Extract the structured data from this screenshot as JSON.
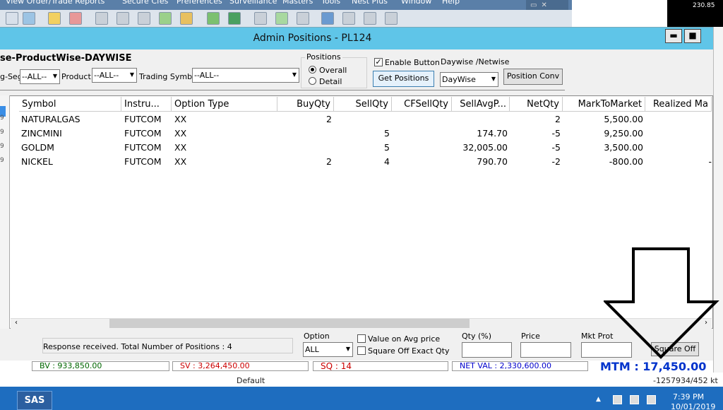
{
  "menu": [
    "View Order/Trade Reports",
    "Secure Cfes",
    "Preferences",
    "Surveillance",
    "Masters",
    "Tools",
    "Nest Plus",
    "Window",
    "Help"
  ],
  "window": {
    "title": "Admin Positions - PL124",
    "minimize": "▬",
    "maximize": "■"
  },
  "heading": "se-ProductWise-DAYWISE",
  "filters": {
    "exseg_label": "g-Seg",
    "exseg_value": "--ALL--",
    "product_label": "Product",
    "product_value": "--ALL--",
    "trading_symbol_label": "Trading Symbol",
    "trading_symbol_value": "--ALL--",
    "positions_group": "Positions",
    "overall": "Overall",
    "detail": "Detail",
    "enable_button": "Enable Button",
    "get_positions": "Get Positions",
    "daywise_label": "Daywise /Netwise",
    "daywise_value": "DayWise",
    "position_conv": "Position Conv"
  },
  "table": {
    "columns": [
      "Symbol",
      "Instru...",
      "Option Type",
      "BuyQty",
      "SellQty",
      "CFSellQty",
      "SellAvgP...",
      "NetQty",
      "MarkToMarket",
      "Realized Ma"
    ],
    "rows": [
      {
        "symbol": "NATURALGAS",
        "instrument": "FUTCOM",
        "option": "XX",
        "buyqty": "2",
        "sellqty": "",
        "cfsellqty": "",
        "sellavg": "",
        "netqty": "2",
        "mtm": "5,500.00",
        "realized": ""
      },
      {
        "symbol": "ZINCMINI",
        "instrument": "FUTCOM",
        "option": "XX",
        "buyqty": "",
        "sellqty": "5",
        "cfsellqty": "",
        "sellavg": "174.70",
        "netqty": "-5",
        "mtm": "9,250.00",
        "realized": ""
      },
      {
        "symbol": "GOLDM",
        "instrument": "FUTCOM",
        "option": "XX",
        "buyqty": "",
        "sellqty": "5",
        "cfsellqty": "",
        "sellavg": "32,005.00",
        "netqty": "-5",
        "mtm": "3,500.00",
        "realized": ""
      },
      {
        "symbol": "NICKEL",
        "instrument": "FUTCOM",
        "option": "XX",
        "buyqty": "2",
        "sellqty": "4",
        "cfsellqty": "",
        "sellavg": "790.70",
        "netqty": "-2",
        "mtm": "-800.00",
        "realized": "-"
      }
    ]
  },
  "bottom": {
    "response": "Response received. Total Number of Positions : 4",
    "option_label": "Option",
    "option_value": "ALL",
    "value_on_avg": "Value on Avg  price",
    "square_off_exact": "Square Off Exact Qty",
    "qty_label": "Qty (%)",
    "price_label": "Price",
    "mkt_prot_label": "Mkt Prot",
    "square_off": "Square Off"
  },
  "status": {
    "bv": "BV : 933,850.00",
    "sv": "SV : 3,264,450.00",
    "sq": "SQ : 14",
    "net_val": "NET VAL : 2,330,600.00",
    "mtm": "MTM : 17,450.00"
  },
  "background": {
    "default_text": "Default",
    "right_number": "-1257934/452 kt",
    "chart_value": "230.85"
  },
  "taskbar": {
    "app": "SAS",
    "time": "7:39 PM",
    "date": "10/01/2019"
  },
  "colors": {
    "titlebar": "#5fc5e8",
    "taskbar": "#1e6dbf",
    "mtm": "#0033cc",
    "sv": "#cc0000",
    "sq": "#cc0000",
    "netval": "#0000cc",
    "bv": "#006600"
  }
}
